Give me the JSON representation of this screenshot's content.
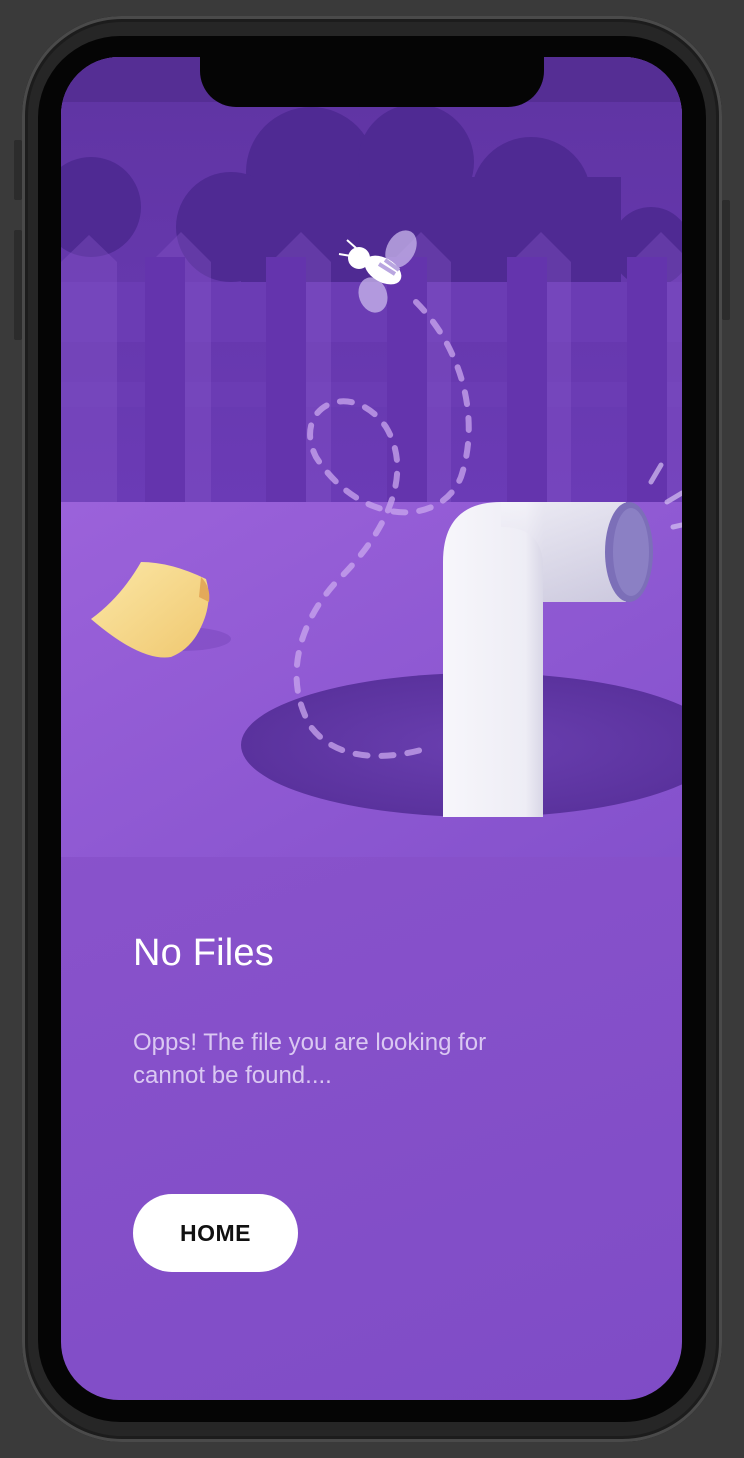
{
  "error": {
    "title": "No Files",
    "message_line1": "Opps! The file you are looking for",
    "message_line2": "cannot be found...."
  },
  "actions": {
    "home_label": "HOME"
  },
  "colors": {
    "background": "#8a53cc",
    "button_bg": "#ffffff",
    "button_text": "#111111",
    "paper_note": "#f7d98a"
  },
  "illustration": {
    "icons": [
      "bee-icon",
      "pipe-icon",
      "paper-note-icon",
      "fence-icon",
      "hole-icon"
    ]
  }
}
